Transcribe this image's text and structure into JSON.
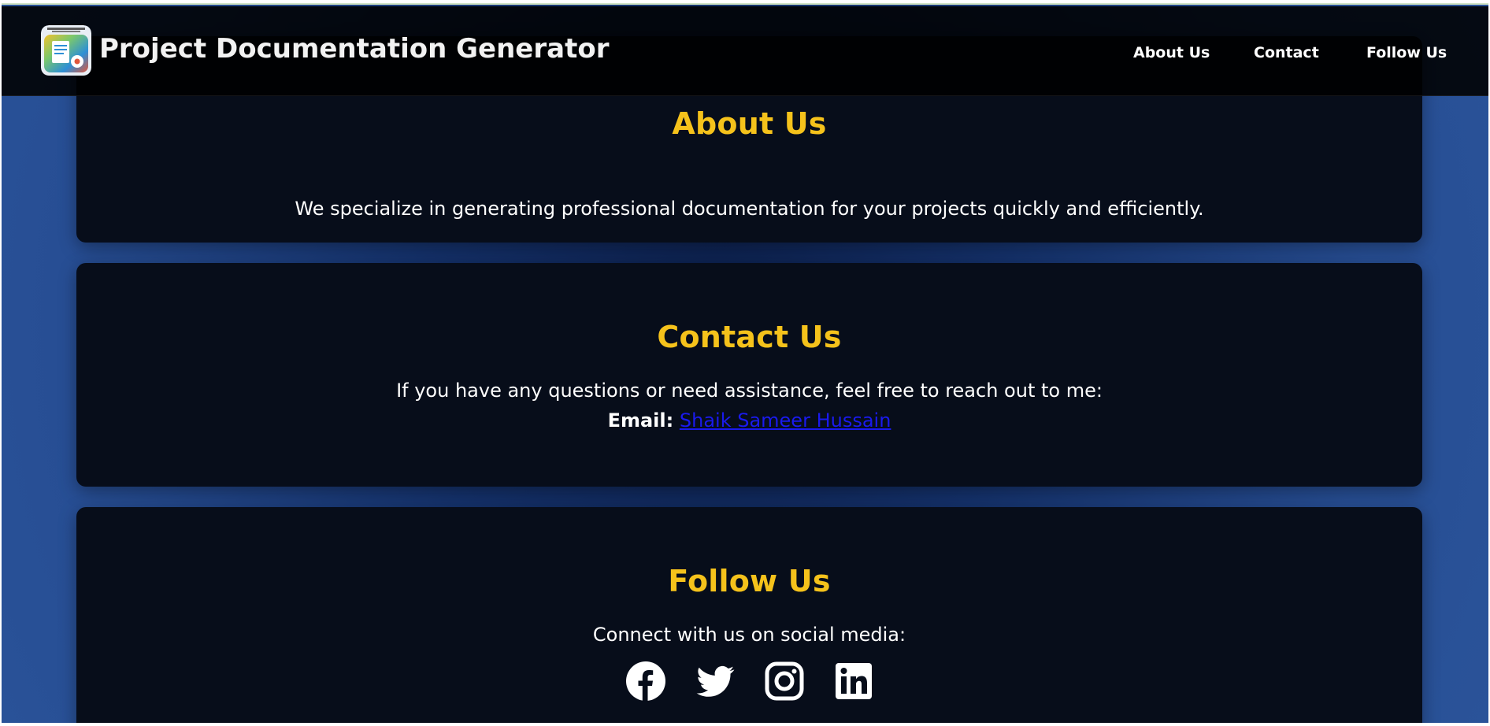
{
  "header": {
    "brand": "Project Documentation Generator",
    "logo_icon": "document-gear-icon",
    "nav": [
      {
        "label": "About Us"
      },
      {
        "label": "Contact"
      },
      {
        "label": "Follow Us"
      }
    ]
  },
  "about": {
    "title": "About Us",
    "text": "We specialize in generating professional documentation for your projects quickly and efficiently."
  },
  "contact": {
    "title": "Contact Us",
    "intro": "If you have any questions or need assistance, feel free to reach out to me:",
    "email_label": "Email:",
    "email_link_text": "Shaik Sameer Hussain"
  },
  "follow": {
    "title": "Follow Us",
    "text": "Connect with us on social media:",
    "icons": [
      "facebook-icon",
      "twitter-icon",
      "instagram-icon",
      "linkedin-icon"
    ]
  },
  "colors": {
    "heading": "#f5c21b",
    "card": "#070d1a",
    "background": "#274e94",
    "link": "#1a1aee"
  }
}
